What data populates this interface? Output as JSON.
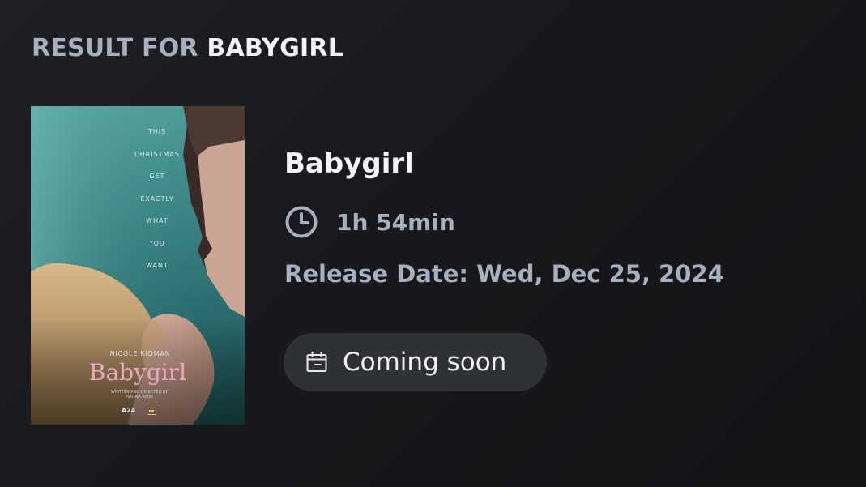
{
  "header": {
    "prefix": "RESULT FOR",
    "query": "BABYGIRL"
  },
  "poster": {
    "tagline": [
      "THIS",
      "CHRISTMAS",
      "GET",
      "EXACTLY",
      "WHAT",
      "YOU",
      "WANT"
    ],
    "actor": "NICOLE KIDMAN",
    "title": "Babygirl",
    "credit_line1": "WRITTEN AND DIRECTED BY",
    "credit_line2": "HALINA REIJN",
    "studio_logo": "A24"
  },
  "movie": {
    "title": "Babygirl",
    "runtime": "1h 54min",
    "release": "Release Date: Wed, Dec 25, 2024",
    "status_label": "Coming soon"
  },
  "icons": {
    "runtime": "clock-icon",
    "status": "calendar-icon"
  },
  "colors": {
    "background": "#1a1b1e",
    "muted_text": "#a7b0c0",
    "primary_text": "#f3f4f6",
    "pill_background": "#2e3136",
    "poster_title": "#e8a7c4"
  }
}
